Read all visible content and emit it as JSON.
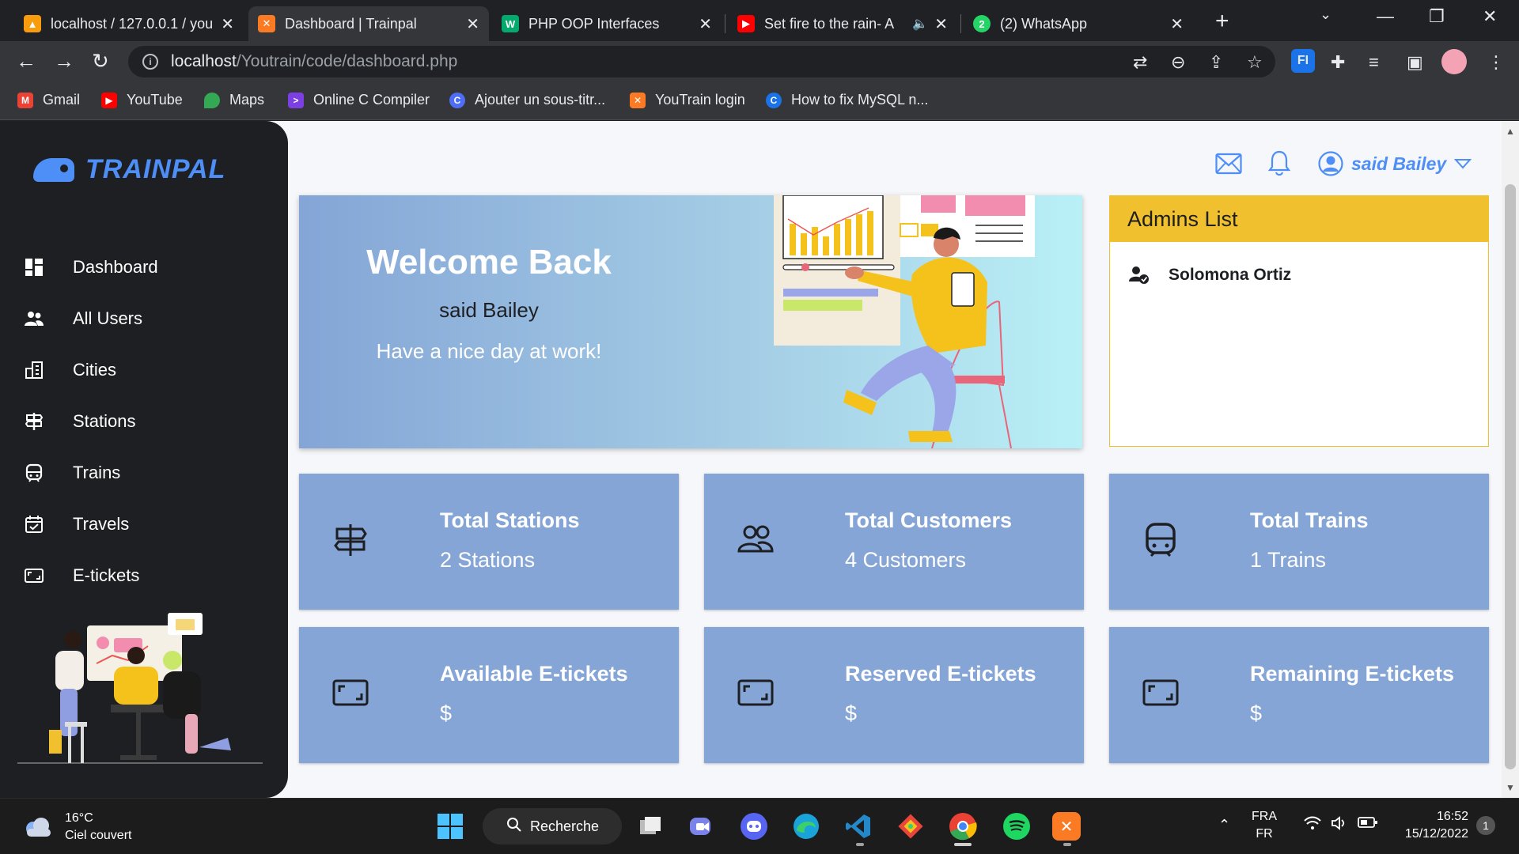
{
  "browser": {
    "tabs": [
      {
        "title": "localhost / 127.0.0.1 / you",
        "favicon": "phpmyadmin-icon",
        "active": false
      },
      {
        "title": "Dashboard | Trainpal",
        "favicon": "xampp-icon",
        "active": true
      },
      {
        "title": "PHP OOP Interfaces",
        "favicon": "w3schools-icon",
        "active": false
      },
      {
        "title": "Set fire to the rain- A",
        "favicon": "youtube-icon",
        "active": false
      },
      {
        "title": "(2) WhatsApp",
        "favicon": "whatsapp-icon",
        "active": false
      }
    ],
    "whatsapp_badge": "2",
    "url_host": "localhost",
    "url_path": "/Youtrain/code/dashboard.php",
    "bookmarks": [
      "Gmail",
      "YouTube",
      "Maps",
      "Online C Compiler",
      "Ajouter un sous-titr...",
      "YouTrain login",
      "How to fix MySQL n..."
    ]
  },
  "app": {
    "brand": "TRAINPAL",
    "nav": [
      {
        "label": "Dashboard",
        "icon": "dashboard-icon"
      },
      {
        "label": "All Users",
        "icon": "users-icon"
      },
      {
        "label": "Cities",
        "icon": "city-icon"
      },
      {
        "label": "Stations",
        "icon": "signpost-icon"
      },
      {
        "label": "Trains",
        "icon": "train-icon"
      },
      {
        "label": "Travels",
        "icon": "calendar-check-icon"
      },
      {
        "label": "E-tickets",
        "icon": "ticket-icon"
      }
    ],
    "user_name": "said Bailey",
    "welcome": {
      "title": "Welcome Back",
      "name": "said Bailey",
      "message": "Have a nice day at work!"
    },
    "admins": {
      "title": "Admins List",
      "items": [
        "Solomona Ortiz"
      ]
    },
    "stats": [
      {
        "title": "Total Stations",
        "value": "2 Stations",
        "icon": "signpost-icon"
      },
      {
        "title": "Total Customers",
        "value": "4 Customers",
        "icon": "customers-icon"
      },
      {
        "title": "Total Trains",
        "value": "1 Trains",
        "icon": "train-icon"
      },
      {
        "title": "Available E-tickets",
        "value": "$",
        "icon": "ticket-icon"
      },
      {
        "title": "Reserved E-tickets",
        "value": "$",
        "icon": "ticket-icon"
      },
      {
        "title": "Remaining E-tickets",
        "value": "$",
        "icon": "ticket-icon"
      }
    ],
    "colors": {
      "accent": "#4e8ef7",
      "sidebar": "#1d1f23",
      "card": "#85a5d6",
      "admins_header": "#f0c02f"
    }
  },
  "taskbar": {
    "temperature": "16°C",
    "weather": "Ciel couvert",
    "search_label": "Recherche",
    "lang_top": "FRA",
    "lang_bottom": "FR",
    "time": "16:52",
    "date": "15/12/2022",
    "notification_count": "1"
  }
}
